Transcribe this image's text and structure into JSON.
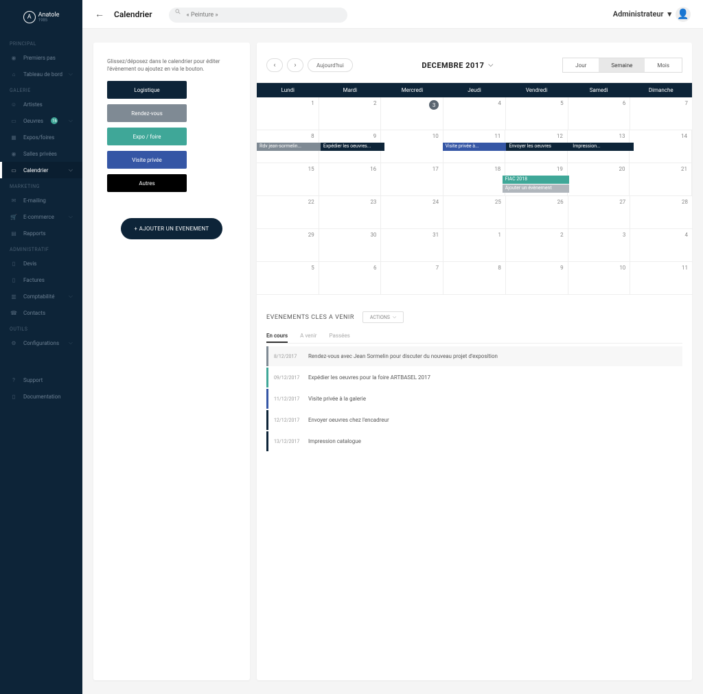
{
  "brand": {
    "name": "Anatole",
    "sub": "1985",
    "initial": "A"
  },
  "header": {
    "title": "Calendrier",
    "search_placeholder": "« Peinture »",
    "user_label": "Administrateur"
  },
  "sidebar": {
    "sections": [
      {
        "label": "PRINCIPAL",
        "items": [
          {
            "icon": "eye",
            "label": "Premiers pas"
          },
          {
            "icon": "home",
            "label": "Tableau de bord",
            "chevron": true
          }
        ]
      },
      {
        "label": "GALERIE",
        "items": [
          {
            "icon": "users",
            "label": "Artistes"
          },
          {
            "icon": "monitor",
            "label": "Oeuvres",
            "badge": "16",
            "chevron": true
          },
          {
            "icon": "calendar",
            "label": "Expos/foires"
          },
          {
            "icon": "eye",
            "label": "Salles privées"
          },
          {
            "icon": "monitor",
            "label": "Calendrier",
            "active": true,
            "chevron": true
          }
        ]
      },
      {
        "label": "MARKETING",
        "items": [
          {
            "icon": "mail",
            "label": "E-mailing"
          },
          {
            "icon": "cart",
            "label": "E-commerce",
            "chevron": true
          },
          {
            "icon": "chart",
            "label": "Rapports"
          }
        ]
      },
      {
        "label": "ADMINISTRATIF",
        "items": [
          {
            "icon": "file",
            "label": "Devis"
          },
          {
            "icon": "file",
            "label": "Factures"
          },
          {
            "icon": "book",
            "label": "Comptabilité",
            "chevron": true
          },
          {
            "icon": "phone",
            "label": "Contacts"
          }
        ]
      },
      {
        "label": "OUTILS",
        "items": [
          {
            "icon": "gear",
            "label": "Configurations",
            "chevron": true
          }
        ]
      }
    ],
    "footer": [
      {
        "icon": "help",
        "label": "Support"
      },
      {
        "icon": "doc",
        "label": "Documentation"
      }
    ]
  },
  "left_panel": {
    "hint": "Glissez/déposez dans le calendrier pour éditer l'évènement ou ajoutez en via le bouton.",
    "categories": [
      {
        "label": "Logistique",
        "cls": "cat-logistique"
      },
      {
        "label": "Rendez-vous",
        "cls": "cat-rdv"
      },
      {
        "label": "Expo / foire",
        "cls": "cat-expo"
      },
      {
        "label": "Visite privée",
        "cls": "cat-visite"
      },
      {
        "label": "Autres",
        "cls": "cat-autres"
      }
    ],
    "add_button": "+ AJOUTER UN EVENEMENT"
  },
  "calendar": {
    "prev": "‹",
    "next": "›",
    "today_label": "Aujourd'hui",
    "month_label": "DECEMBRE 2017",
    "views": [
      "Jour",
      "Semaine",
      "Mois"
    ],
    "active_view": "Semaine",
    "weekdays": [
      "Lundi",
      "Mardi",
      "Mercredi",
      "Jeudi",
      "Vendredi",
      "Samedi",
      "Dimanche"
    ],
    "rows": [
      {
        "days": [
          1,
          2,
          3,
          4,
          5,
          6,
          7
        ],
        "today_idx": 2,
        "events": []
      },
      {
        "days": [
          8,
          9,
          10,
          11,
          12,
          13,
          14
        ],
        "events": [
          {
            "row": 0,
            "start": 0,
            "span": 1,
            "cls": "evt-gray",
            "text": "Rdv jean-sormelin..."
          },
          {
            "row": 0,
            "start": 1,
            "span": 1,
            "cls": "evt-dark",
            "text": "Expédier les oeuvres..."
          },
          {
            "row": 0,
            "start": 3,
            "span": 1,
            "cls": "evt-blue",
            "text": "Visite privée à..."
          },
          {
            "row": 0,
            "start": 4,
            "span": 1,
            "cls": "evt-dark",
            "text": "Envoyer les oeuvres"
          },
          {
            "row": 0,
            "start": 5,
            "span": 1,
            "cls": "evt-dark",
            "text": "Impression..."
          }
        ]
      },
      {
        "days": [
          15,
          16,
          17,
          18,
          19,
          20,
          21
        ],
        "events": [
          {
            "row": 0,
            "start": 4,
            "span": 1,
            "cls": "evt-teal",
            "text": "FIAC 2018"
          },
          {
            "row": 1,
            "start": 4,
            "span": 1,
            "cls": "evt-lightgray",
            "text": "Ajouter un évènement"
          }
        ]
      },
      {
        "days": [
          22,
          23,
          24,
          25,
          26,
          27,
          28
        ],
        "events": []
      },
      {
        "days": [
          29,
          30,
          31,
          1,
          2,
          3,
          4
        ],
        "events": []
      },
      {
        "days": [
          5,
          6,
          7,
          8,
          9,
          10,
          11
        ],
        "events": []
      }
    ]
  },
  "upcoming": {
    "title": "EVENEMENTS CLES A VENIR",
    "actions_label": "ACTIONS",
    "tabs": [
      "En cours",
      "A venir",
      "Passées"
    ],
    "active_tab": "En cours",
    "items": [
      {
        "cls": "gray",
        "date": "8/12/2017",
        "text": "Rendez-vous avec Jean Sormelin pour discuter du nouveau projet d'exposition"
      },
      {
        "cls": "teal",
        "date": "09/12/2017",
        "text": "Expédier les oeuvres pour la foire ARTBASEL 2017"
      },
      {
        "cls": "blue",
        "date": "11/12/2017",
        "text": "Visite privée à la galerie"
      },
      {
        "cls": "dark",
        "date": "12/12/2017",
        "text": "Envoyer oeuvres chez l'encadreur"
      },
      {
        "cls": "dark",
        "date": "13/12/2017",
        "text": "Impression catalogue"
      }
    ]
  }
}
